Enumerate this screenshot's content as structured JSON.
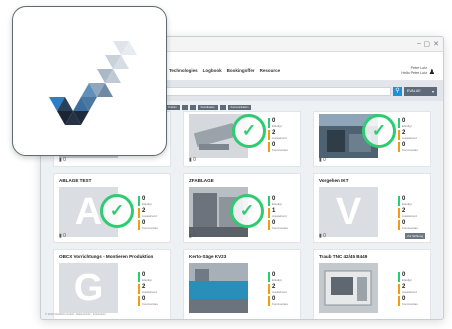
{
  "browser": {
    "min": "–",
    "max": "▢",
    "close": "✕"
  },
  "nav": {
    "links": [
      "Technologies",
      "Logbook",
      "Bookingoffer",
      "Resource"
    ],
    "user_line1": "Peter Lutz",
    "user_line2": "Hello Peter Lutz"
  },
  "search": {
    "placeholder": "",
    "button_icon": "search-icon",
    "dropdown_label": "EVALUE"
  },
  "filters": [
    "Fräsen",
    "Drehen",
    "",
    "",
    "Koordinaten",
    "",
    "Kommunikation"
  ],
  "cards": [
    {
      "title": "",
      "type": "photo",
      "check": true,
      "stats": [
        "0",
        "2",
        "0"
      ],
      "comments": "0",
      "tag": ""
    },
    {
      "title": "",
      "type": "photo",
      "check": true,
      "stats": [
        "0",
        "2",
        "0"
      ],
      "comments": "0",
      "tag": ""
    },
    {
      "title": "",
      "type": "photo",
      "check": true,
      "stats": [
        "0",
        "2",
        "0"
      ],
      "comments": "0",
      "tag": ""
    },
    {
      "title": "ABLAGE TEST",
      "type": "letter",
      "letter": "A",
      "letter_color": "#c7ccd1",
      "check": true,
      "stats": [
        "0",
        "2",
        "0"
      ],
      "comments": "0",
      "tag": ""
    },
    {
      "title": "ZFABLAGE",
      "type": "photo",
      "check": true,
      "stats": [
        "0",
        "1",
        "0"
      ],
      "comments": "0",
      "tag": ""
    },
    {
      "title": "Vorgehen IKT",
      "type": "letter",
      "letter": "V",
      "letter_color": "#c7ccd1",
      "check": false,
      "stats": [
        "0",
        "2",
        "0"
      ],
      "comments": "0",
      "tag": "Zur Sichtung"
    },
    {
      "title": "OBCX Vorrichtungs - Montieren Produktion",
      "type": "letter",
      "letter": "G",
      "letter_color": "#c7ccd1",
      "check": false,
      "stats": [
        "0",
        "2",
        "0"
      ],
      "comments": "",
      "tag": ""
    },
    {
      "title": "Kerto-Säge KV23",
      "type": "photo",
      "check": false,
      "stats": [
        "0",
        "2",
        "0"
      ],
      "comments": "",
      "tag": ""
    },
    {
      "title": "Traub TNC 42/45 B449",
      "type": "photo",
      "check": false,
      "stats": [
        "0",
        "2",
        "0"
      ],
      "comments": "",
      "tag": ""
    }
  ],
  "stat_labels": [
    "Erledigt",
    "Ausstehend",
    "Kommentare"
  ],
  "footer": "© 2019 Checkbox GmbH · Datenschutz · Impressum"
}
